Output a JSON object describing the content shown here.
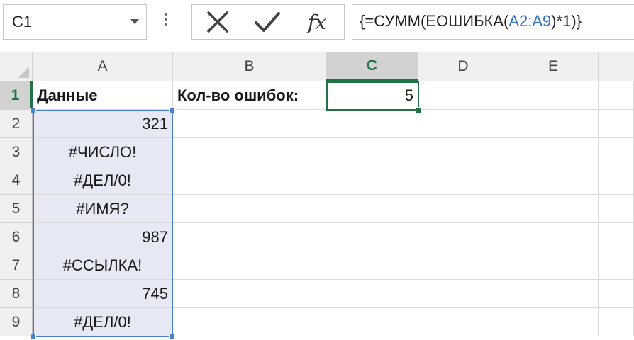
{
  "name_box": {
    "value": "C1"
  },
  "formula_bar": {
    "cancel_icon": "close-icon",
    "enter_icon": "check-icon",
    "fx_label": "fx",
    "formula_prefix": "{=СУММ(ЕОШИБКА(",
    "formula_ref": "A2:A9",
    "formula_suffix": ")*1)}"
  },
  "columns": [
    "A",
    "B",
    "C",
    "D",
    "E"
  ],
  "selected_column": "C",
  "rows": [
    "1",
    "2",
    "3",
    "4",
    "5",
    "6",
    "7",
    "8",
    "9"
  ],
  "cells": {
    "A1": "Данные",
    "B1": "Кол-во ошибок:",
    "C1": "5",
    "A2": "321",
    "A3": "#ЧИСЛО!",
    "A4": "#ДЕЛ/0!",
    "A5": "#ИМЯ?",
    "A6": "987",
    "A7": "#ССЫЛКА!",
    "A8": "745",
    "A9": "#ДЕЛ/0!"
  },
  "colors": {
    "excel_green": "#217346",
    "reference_blue": "#4a7fc9",
    "range_fill": "#e6e8f3"
  }
}
